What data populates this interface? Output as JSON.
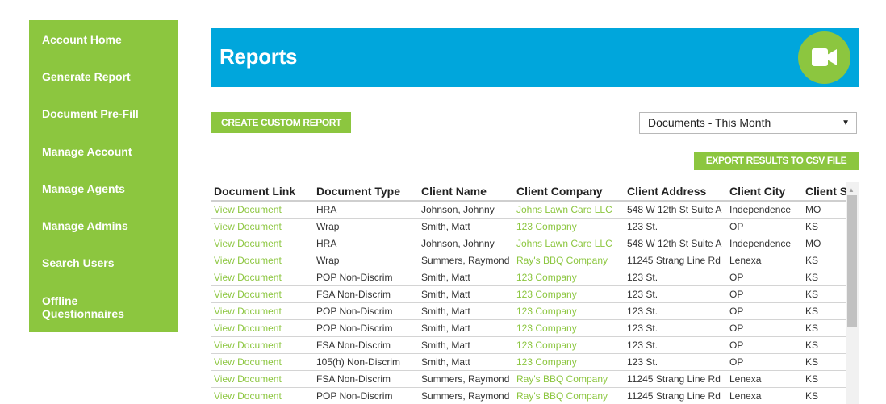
{
  "sidebar": {
    "items": [
      {
        "label": "Account Home"
      },
      {
        "label": "Generate Report"
      },
      {
        "label": "Document Pre-Fill"
      },
      {
        "label": "Manage Account"
      },
      {
        "label": "Manage Agents"
      },
      {
        "label": "Manage Admins"
      },
      {
        "label": "Search Users"
      },
      {
        "label": "Offline Questionnaires"
      }
    ]
  },
  "header": {
    "title": "Reports",
    "video_icon": "video-camera-icon"
  },
  "toolbar": {
    "create_label": "CREATE CUSTOM REPORT",
    "filter_selected": "Documents - This Month",
    "export_label": "EXPORT RESULTS TO CSV FILE"
  },
  "colors": {
    "brand_green": "#8cc63f",
    "header_blue": "#00a6dc"
  },
  "table": {
    "columns": [
      "Document Link",
      "Document Type",
      "Client Name",
      "Client Company",
      "Client Address",
      "Client City",
      "Client State"
    ],
    "rows": [
      [
        "View Document",
        "HRA",
        "Johnson, Johnny",
        "Johns Lawn Care LLC",
        "548 W 12th St Suite A",
        "Independence",
        "MO"
      ],
      [
        "View Document",
        "Wrap",
        "Smith, Matt",
        "123 Company",
        "123 St.",
        "OP",
        "KS"
      ],
      [
        "View Document",
        "HRA",
        "Johnson, Johnny",
        "Johns Lawn Care LLC",
        "548 W 12th St Suite A",
        "Independence",
        "MO"
      ],
      [
        "View Document",
        "Wrap",
        "Summers, Raymond",
        "Ray's BBQ Company",
        "11245 Strang Line Rd",
        "Lenexa",
        "KS"
      ],
      [
        "View Document",
        "POP Non-Discrim",
        "Smith, Matt",
        "123 Company",
        "123 St.",
        "OP",
        "KS"
      ],
      [
        "View Document",
        "FSA Non-Discrim",
        "Smith, Matt",
        "123 Company",
        "123 St.",
        "OP",
        "KS"
      ],
      [
        "View Document",
        "POP Non-Discrim",
        "Smith, Matt",
        "123 Company",
        "123 St.",
        "OP",
        "KS"
      ],
      [
        "View Document",
        "POP Non-Discrim",
        "Smith, Matt",
        "123 Company",
        "123 St.",
        "OP",
        "KS"
      ],
      [
        "View Document",
        "FSA Non-Discrim",
        "Smith, Matt",
        "123 Company",
        "123 St.",
        "OP",
        "KS"
      ],
      [
        "View Document",
        "105(h) Non-Discrim",
        "Smith, Matt",
        "123 Company",
        "123 St.",
        "OP",
        "KS"
      ],
      [
        "View Document",
        "FSA Non-Discrim",
        "Summers, Raymond",
        "Ray's BBQ Company",
        "11245 Strang Line Rd",
        "Lenexa",
        "KS"
      ],
      [
        "View Document",
        "POP Non-Discrim",
        "Summers, Raymond",
        "Ray's BBQ Company",
        "11245 Strang Line Rd",
        "Lenexa",
        "KS"
      ]
    ]
  }
}
